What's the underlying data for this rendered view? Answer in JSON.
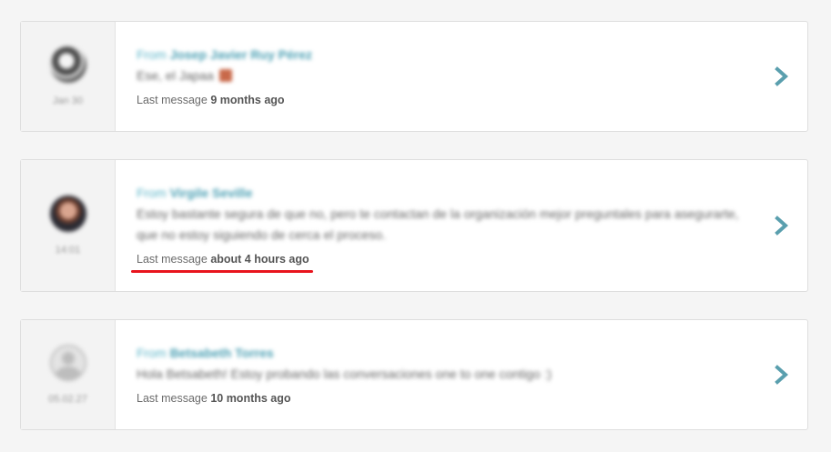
{
  "conversations": [
    {
      "date": "Jan 30",
      "from_prefix": "From",
      "from_name": "Josep Javier Ruy Pérez",
      "preview": "Ese, el Japaa",
      "last_label": "Last message",
      "last_ago": "9 months ago"
    },
    {
      "date": "14:01",
      "from_prefix": "From",
      "from_name": "Virgile Seville",
      "preview": "Estoy bastante segura de que no, pero te contactan de la organización mejor preguntales para asegurarte, que no estoy siguiendo de cerca el proceso.",
      "last_label": "Last message",
      "last_ago": "about 4 hours ago"
    },
    {
      "date": "05.02.27",
      "from_prefix": "From",
      "from_name": "Betsabeth Torres",
      "preview": "Hola Betsabeth! Estoy probando las conversaciones one to one contigo :)",
      "last_label": "Last message",
      "last_ago": "10 months ago"
    }
  ],
  "icons": {
    "open": "chevron-right-icon"
  },
  "colors": {
    "accent": "#5a9fae",
    "highlight": "#e8141d"
  }
}
